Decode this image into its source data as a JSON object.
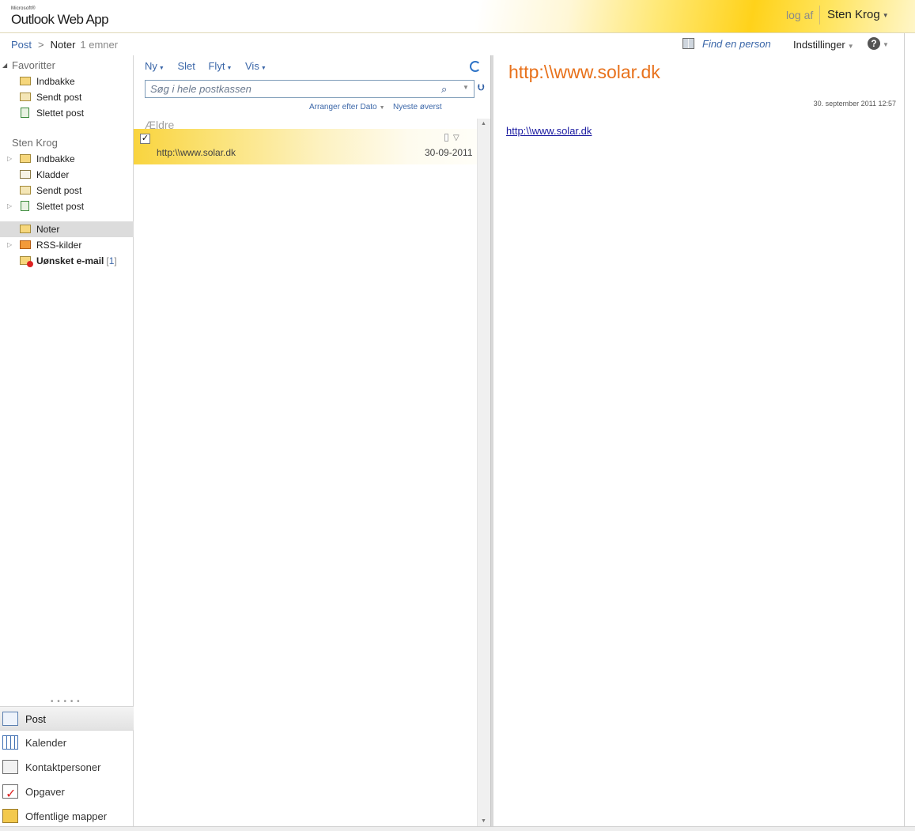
{
  "header": {
    "ms_label": "Microsoft®",
    "app_name": "Outlook Web App",
    "signout": "log af",
    "user": "Sten Krog"
  },
  "breadcrumb": {
    "root": "Post",
    "separator": ">",
    "current": "Noter",
    "count": "1 emner"
  },
  "topbar": {
    "find_person": "Find en person",
    "settings": "Indstillinger",
    "help": "?"
  },
  "nav": {
    "favorites": {
      "title": "Favoritter",
      "items": [
        {
          "label": "Indbakke",
          "icon": "inbox-icon"
        },
        {
          "label": "Sendt post",
          "icon": "sent-icon"
        },
        {
          "label": "Slettet post",
          "icon": "deleted-icon"
        }
      ]
    },
    "mailbox": {
      "title": "Sten Krog",
      "items": [
        {
          "label": "Indbakke",
          "icon": "inbox-icon"
        },
        {
          "label": "Kladder",
          "icon": "drafts-icon"
        },
        {
          "label": "Sendt post",
          "icon": "sent-icon"
        },
        {
          "label": "Slettet post",
          "icon": "deleted-icon"
        },
        {
          "label": "Noter",
          "icon": "notes-icon",
          "selected": true
        },
        {
          "label": "RSS-kilder",
          "icon": "rss-icon"
        },
        {
          "label": "Uønsket e-mail",
          "icon": "junk-icon",
          "unread": "1"
        }
      ]
    },
    "modules": [
      {
        "label": "Post",
        "icon": "mail-icon",
        "active": true
      },
      {
        "label": "Kalender",
        "icon": "calendar-icon"
      },
      {
        "label": "Kontaktpersoner",
        "icon": "contacts-icon"
      },
      {
        "label": "Opgaver",
        "icon": "tasks-icon"
      },
      {
        "label": "Offentlige mapper",
        "icon": "public-folders-icon"
      }
    ]
  },
  "list": {
    "toolbar": {
      "new": "Ny",
      "delete": "Slet",
      "move": "Flyt",
      "view": "Vis"
    },
    "search_placeholder": "Søg i hele postkassen",
    "arrange_by": "Arranger efter Dato",
    "sort_order": "Nyeste øverst",
    "group_header": "Ældre",
    "items": [
      {
        "subject": "http:\\\\www.solar.dk",
        "date": "30-09-2011",
        "checked": true
      }
    ]
  },
  "reading": {
    "subject": "http:\\\\www.solar.dk",
    "datetime": "30. september 2011 12:57",
    "body_link": "http:\\\\www.solar.dk"
  },
  "colors": {
    "accent_orange": "#e8711b",
    "link_blue": "#3a66a8",
    "selection_yellow": "#f9d43e"
  }
}
